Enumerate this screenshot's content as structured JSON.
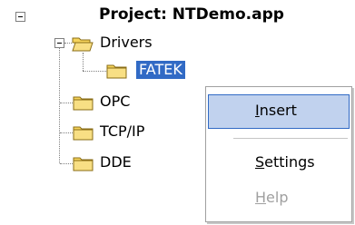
{
  "tree": {
    "root": {
      "label": "Project: NTDemo.app"
    },
    "drivers": {
      "label": "Drivers"
    },
    "fatek": {
      "label": "FATEK"
    },
    "opc": {
      "label": "OPC"
    },
    "tcpip": {
      "label": "TCP/IP"
    },
    "dde": {
      "label": "DDE"
    }
  },
  "context_menu": {
    "items": [
      {
        "label": "Insert",
        "mnemonic": "I",
        "rest": "nsert",
        "state": "hovered"
      },
      {
        "label": "Settings",
        "mnemonic": "S",
        "rest": "ettings",
        "state": "enabled"
      },
      {
        "label": "Help",
        "mnemonic": "H",
        "rest": "elp",
        "state": "disabled"
      }
    ]
  },
  "colors": {
    "selection": "#316ac5",
    "menu_hover": "#c1d2ee",
    "folder": "#f5d35b"
  },
  "icons": {
    "collapse": "minus-box-icon",
    "folder_closed": "folder-icon",
    "folder_open": "folder-open-icon"
  }
}
